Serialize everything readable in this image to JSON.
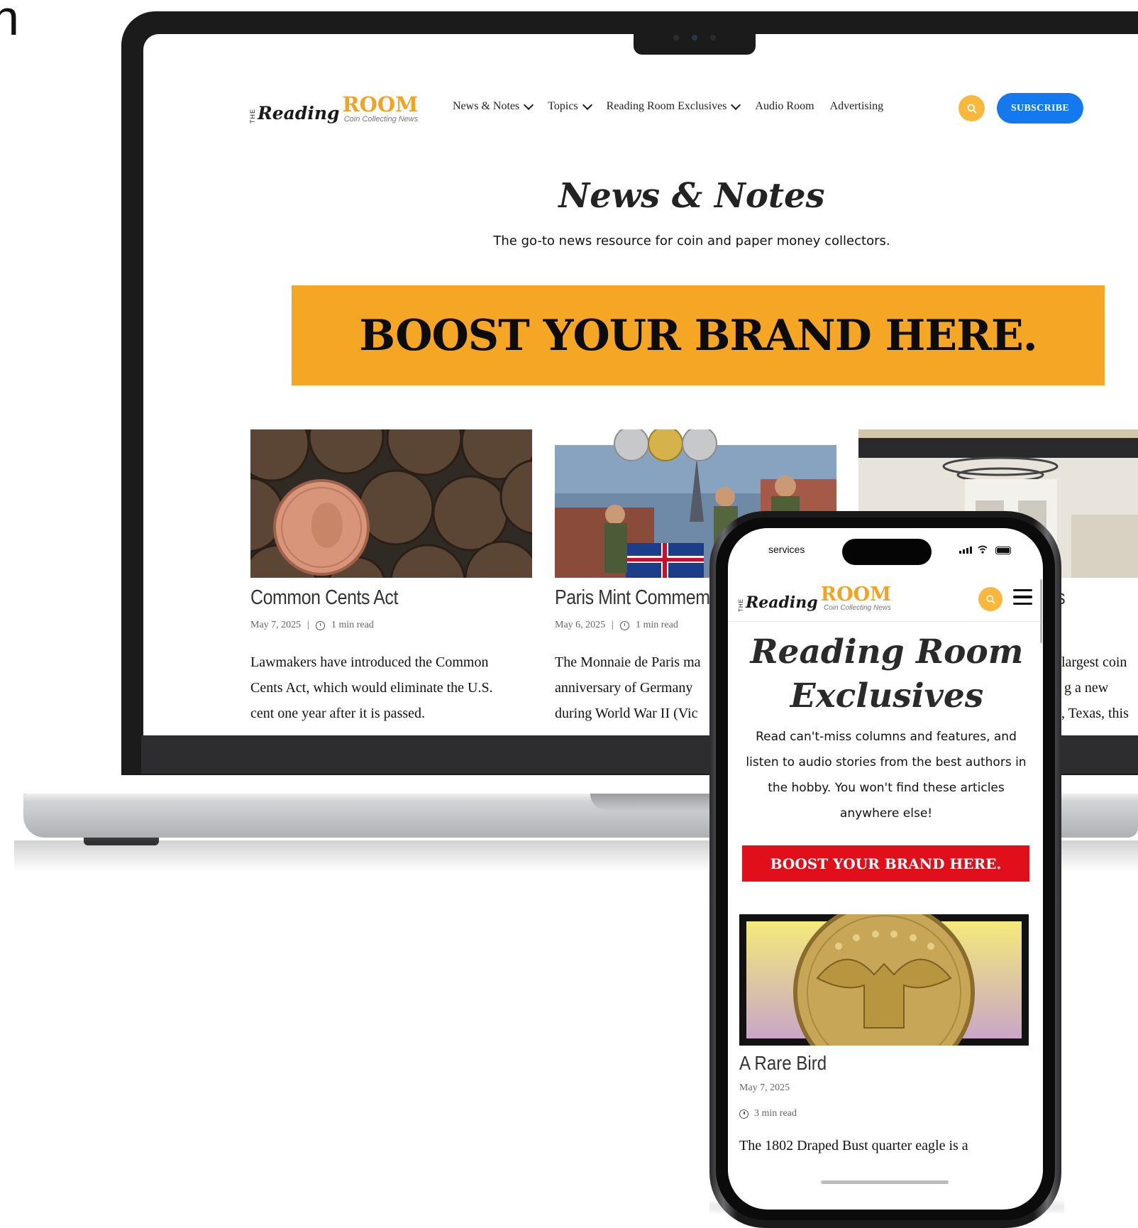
{
  "edge_glyph": "n",
  "desktop": {
    "logo": {
      "the": "THE",
      "reading": "Reading",
      "room": "ROOM",
      "tagline": "Coin Collecting News"
    },
    "nav": [
      {
        "label": "News & Notes",
        "dropdown": true
      },
      {
        "label": "Topics",
        "dropdown": true
      },
      {
        "label": "Reading Room Exclusives",
        "dropdown": true
      },
      {
        "label": "Audio Room",
        "dropdown": false
      },
      {
        "label": "Advertising",
        "dropdown": false
      }
    ],
    "search_icon": "search-icon",
    "subscribe_label": "SUBSCRIBE",
    "page_title": "News & Notes",
    "page_subtitle": "The go-to news resource for coin and paper money collectors.",
    "banner_text": "BOOST YOUR BRAND HERE.",
    "cards": [
      {
        "title": "Common Cents Act",
        "date": "May 7, 2025",
        "read_time": "1 min read",
        "excerpt": [
          "Lawmakers have introduced the Common",
          "Cents Act, which would eliminate the U.S.",
          "cent one year after it is passed."
        ]
      },
      {
        "title": "Paris Mint Commemor",
        "date": "May 6, 2025",
        "read_time": "1 min read",
        "excerpt": [
          "The Monnaie de Paris ma",
          "anniversary of Germany",
          "during World War II (Vic"
        ]
      },
      {
        "title": "ls",
        "excerpt": [
          "largest coin",
          "g a new",
          ", Texas, this"
        ]
      }
    ],
    "colors": {
      "accent_orange": "#f4a624",
      "subscribe_blue": "#1479ee",
      "search_yellow": "#f7b83d"
    }
  },
  "mobile": {
    "status_text": "services",
    "logo": {
      "the": "THE",
      "reading": "Reading",
      "room": "ROOM",
      "tagline": "Coin Collecting News"
    },
    "search_icon": "search-icon",
    "menu_icon": "hamburger-menu-icon",
    "page_title": "Reading Room Exclusives",
    "page_subtitle": "Read can't-miss columns and features, and listen to audio stories from the best authors in the hobby. You won't find these articles anywhere else!",
    "banner_text": "BOOST YOUR BRAND HERE.",
    "card": {
      "title": "A Rare Bird",
      "date": "May 7, 2025",
      "read_time": "3 min read",
      "excerpt": "The 1802 Draped Bust quarter eagle is a"
    },
    "colors": {
      "banner_red": "#e10f1a"
    }
  }
}
